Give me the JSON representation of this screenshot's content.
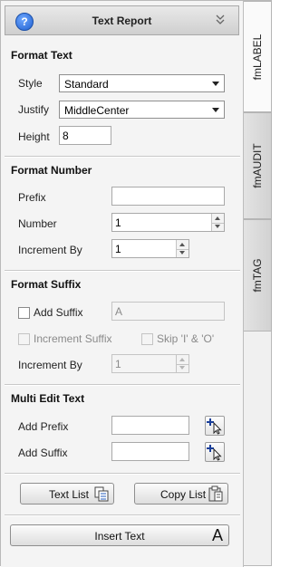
{
  "header": {
    "title": "Text Report",
    "help_icon": "?"
  },
  "format_text": {
    "section_title": "Format Text",
    "style_label": "Style",
    "style_value": "Standard",
    "justify_label": "Justify",
    "justify_value": "MiddleCenter",
    "height_label": "Height",
    "height_value": "8"
  },
  "format_number": {
    "section_title": "Format Number",
    "prefix_label": "Prefix",
    "prefix_value": "",
    "number_label": "Number",
    "number_value": "1",
    "increment_label": "Increment By",
    "increment_value": "1"
  },
  "format_suffix": {
    "section_title": "Format Suffix",
    "add_suffix_label": "Add Suffix",
    "suffix_value": "A",
    "increment_suffix_label": "Increment Suffix",
    "skip_label": "Skip 'I'  & 'O'",
    "increment_label": "Increment By",
    "increment_value": "1"
  },
  "multi_edit": {
    "section_title": "Multi Edit Text",
    "add_prefix_label": "Add Prefix",
    "add_prefix_value": "",
    "add_suffix_label": "Add Suffix",
    "add_suffix_value": ""
  },
  "buttons": {
    "text_list": "Text List",
    "copy_list": "Copy List",
    "insert_text": "Insert Text",
    "insert_icon": "A"
  },
  "tabs": [
    "fmLABEL",
    "fmAUDIT",
    "fmTAG"
  ]
}
